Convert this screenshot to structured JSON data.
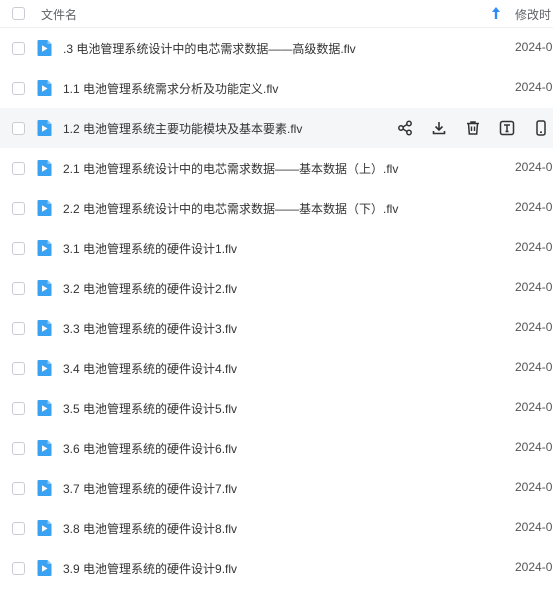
{
  "header": {
    "name_col": "文件名",
    "time_col": "修改时"
  },
  "files": [
    {
      "name": ".3 电池管理系统设计中的电芯需求数据——高级数据.flv",
      "time": "2024-0"
    },
    {
      "name": "1.1 电池管理系统需求分析及功能定义.flv",
      "time": "2024-0"
    },
    {
      "name": "1.2 电池管理系统主要功能模块及基本要素.flv",
      "time": ""
    },
    {
      "name": "2.1 电池管理系统设计中的电芯需求数据——基本数据（上）.flv",
      "time": "2024-0"
    },
    {
      "name": "2.2 电池管理系统设计中的电芯需求数据——基本数据（下）.flv",
      "time": "2024-0"
    },
    {
      "name": "3.1 电池管理系统的硬件设计1.flv",
      "time": "2024-0"
    },
    {
      "name": "3.2 电池管理系统的硬件设计2.flv",
      "time": "2024-0"
    },
    {
      "name": "3.3 电池管理系统的硬件设计3.flv",
      "time": "2024-0"
    },
    {
      "name": "3.4 电池管理系统的硬件设计4.flv",
      "time": "2024-0"
    },
    {
      "name": "3.5 电池管理系统的硬件设计5.flv",
      "time": "2024-0"
    },
    {
      "name": "3.6 电池管理系统的硬件设计6.flv",
      "time": "2024-0"
    },
    {
      "name": "3.7 电池管理系统的硬件设计7.flv",
      "time": "2024-0"
    },
    {
      "name": "3.8 电池管理系统的硬件设计8.flv",
      "time": "2024-0"
    },
    {
      "name": "3.9 电池管理系统的硬件设计9.flv",
      "time": "2024-0"
    }
  ],
  "hover_row": 2,
  "hover_actions": [
    "share-icon",
    "download-icon",
    "delete-icon",
    "rename-icon",
    "mobile-icon"
  ],
  "colors": {
    "accent": "#2f8cf6",
    "video_icon": "#3aa2f3"
  }
}
